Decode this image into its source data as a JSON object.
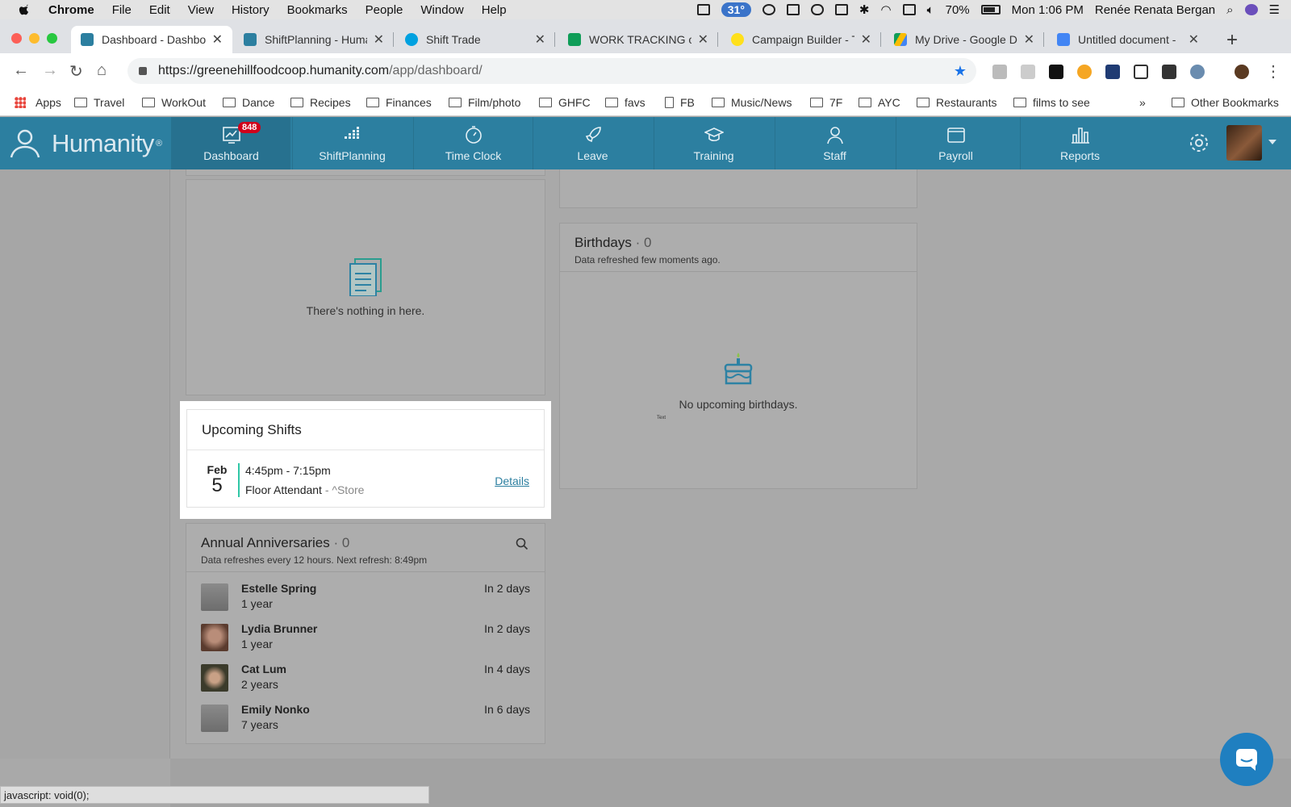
{
  "menubar": {
    "app": "Chrome",
    "menus": [
      "File",
      "Edit",
      "View",
      "History",
      "Bookmarks",
      "People",
      "Window",
      "Help"
    ],
    "temperature": "31°",
    "battery": "70%",
    "clock": "Mon 1:06 PM",
    "user": "Renée Renata Bergan"
  },
  "tabs": [
    {
      "label": "Dashboard - Dashbo",
      "favicon_color": "#2c7fa0"
    },
    {
      "label": "ShiftPlanning - Huma",
      "favicon_color": "#2c7fa0"
    },
    {
      "label": "Shift Trade",
      "favicon_color": "#00a1e0"
    },
    {
      "label": "WORK TRACKING of",
      "favicon_color": "#0f9d58"
    },
    {
      "label": "Campaign Builder - T",
      "favicon_color": "#ffe01b"
    },
    {
      "label": "My Drive - Google D",
      "favicon_color": "#fbbc04"
    },
    {
      "label": "Untitled document -",
      "favicon_color": "#4285f4"
    }
  ],
  "address": {
    "url_host": "https://greenehillfoodcoop.humanity.com",
    "url_path": "/app/dashboard/"
  },
  "bookmarks": {
    "apps": "Apps",
    "items": [
      "Travel",
      "WorkOut",
      "Dance",
      "Recipes",
      "Finances",
      "Film/photo",
      "GHFC",
      "favs",
      "FB",
      "Music/News",
      "7F",
      "AYC",
      "Restaurants",
      "films to see"
    ],
    "overflow": "»",
    "other": "Other Bookmarks"
  },
  "humanity": {
    "brand": "Humanity",
    "reg": "®",
    "nav": [
      {
        "label": "Dashboard",
        "icon": "dashboard-icon",
        "badge": "848"
      },
      {
        "label": "ShiftPlanning",
        "icon": "shiftplanning-icon"
      },
      {
        "label": "Time Clock",
        "icon": "stopwatch-icon"
      },
      {
        "label": "Leave",
        "icon": "rocket-icon"
      },
      {
        "label": "Training",
        "icon": "graduation-cap-icon"
      },
      {
        "label": "Staff",
        "icon": "person-icon"
      },
      {
        "label": "Payroll",
        "icon": "wallet-icon"
      },
      {
        "label": "Reports",
        "icon": "bar-chart-icon"
      }
    ]
  },
  "empty_card": {
    "text": "There's nothing in here."
  },
  "birthdays": {
    "title": "Birthdays",
    "count": "· 0",
    "subtitle": "Data refreshed few moments ago.",
    "empty": "No upcoming birthdays.",
    "tiny": "Text"
  },
  "upcoming": {
    "title": "Upcoming Shifts",
    "month": "Feb",
    "day": "5",
    "time": "4:45pm - 7:15pm",
    "role": "Floor Attendant",
    "location": " - ^Store",
    "details": "Details"
  },
  "anniversaries": {
    "title": "Annual Anniversaries",
    "count": "· 0",
    "subtitle": "Data refreshes every 12 hours. Next refresh: 8:49pm",
    "people": [
      {
        "name": "Estelle Spring",
        "years": "1 year",
        "when": "In 2 days"
      },
      {
        "name": "Lydia Brunner",
        "years": "1 year",
        "when": "In 2 days"
      },
      {
        "name": "Cat Lum",
        "years": "2 years",
        "when": "In 4 days"
      },
      {
        "name": "Emily Nonko",
        "years": "7 years",
        "when": "In 6 days"
      }
    ]
  },
  "statusbar": {
    "text": "javascript: void(0);"
  },
  "colors": {
    "brand": "#2c7fa0",
    "accent": "#2fc7a6",
    "badge": "#d0021b"
  }
}
